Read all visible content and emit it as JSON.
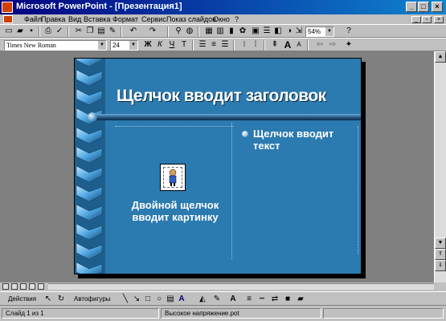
{
  "window": {
    "title": "Microsoft PowerPoint - [Презентация1]",
    "min": "_",
    "max": "□",
    "close": "×"
  },
  "menu": {
    "items": [
      "Файл",
      "Правка",
      "Вид",
      "Вставка",
      "Формат",
      "Сервис",
      "Показ слайдов",
      "Окно",
      "?"
    ]
  },
  "toolbar": {
    "zoom": "54%",
    "font": "Times New Roman",
    "size": "24",
    "bold": "Ж",
    "italic": "К",
    "underline": "Ч",
    "shadow": "Т",
    "font_color": "A"
  },
  "slide": {
    "title": "Щелчок вводит заголовок",
    "bullet": "Щелчок вводит текст",
    "picture_caption": "Двойной щелчок вводит картинку"
  },
  "drawing": {
    "actions": "Действия",
    "autoshapes": "Автофигуры"
  },
  "status": {
    "slide": "Слайд 1 из 1",
    "template": "Высокое напряжение.pot"
  },
  "colors": {
    "slide_bg": "#2b7ab0",
    "titlebar": "#000080"
  }
}
